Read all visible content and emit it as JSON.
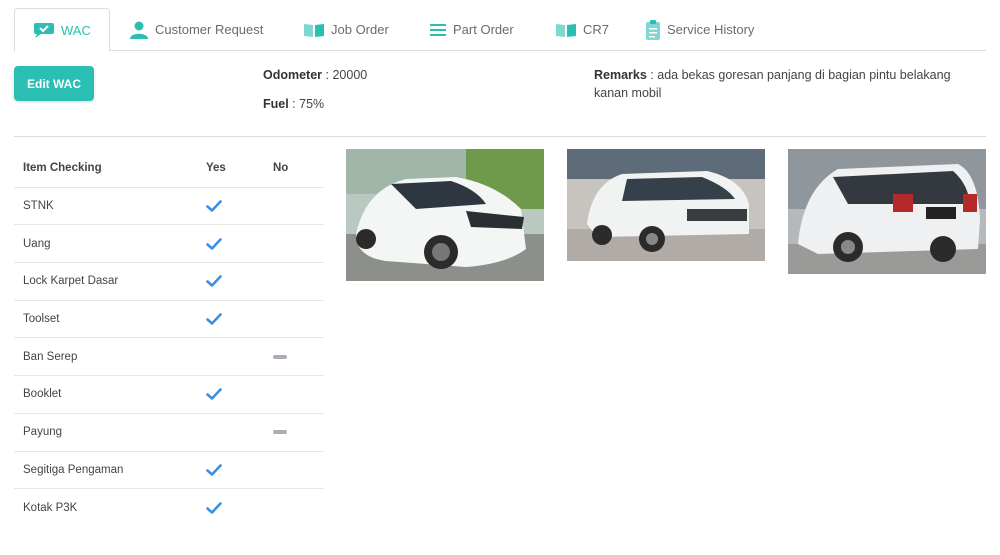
{
  "tabs": [
    {
      "label": "WAC",
      "icon": "wac-icon",
      "active": true
    },
    {
      "label": "Customer Request",
      "icon": "user-icon",
      "active": false
    },
    {
      "label": "Job Order",
      "icon": "book-icon",
      "active": false
    },
    {
      "label": "Part Order",
      "icon": "list-icon",
      "active": false
    },
    {
      "label": "CR7",
      "icon": "book-icon",
      "active": false
    },
    {
      "label": "Service History",
      "icon": "clipboard-icon",
      "active": false
    }
  ],
  "actions": {
    "edit_label": "Edit WAC"
  },
  "info": {
    "odometer_label": "Odometer",
    "odometer_value": "20000",
    "fuel_label": "Fuel",
    "fuel_value": "75%",
    "remarks_label": "Remarks",
    "remarks_value": "ada bekas goresan panjang di bagian pintu belakang kanan mobil"
  },
  "checklist": {
    "headers": {
      "item": "Item Checking",
      "yes": "Yes",
      "no": "No"
    },
    "items": [
      {
        "name": "STNK",
        "status": "yes"
      },
      {
        "name": "Uang",
        "status": "yes"
      },
      {
        "name": "Lock Karpet Dasar",
        "status": "yes"
      },
      {
        "name": "Toolset",
        "status": "yes"
      },
      {
        "name": "Ban Serep",
        "status": "no"
      },
      {
        "name": "Booklet",
        "status": "yes"
      },
      {
        "name": "Payung",
        "status": "no"
      },
      {
        "name": "Segitiga Pengaman",
        "status": "yes"
      },
      {
        "name": "Kotak P3K",
        "status": "yes"
      }
    ]
  },
  "colors": {
    "accent": "#2bbfb3",
    "check": "#3d8fe0",
    "dash": "#a9aeb6"
  }
}
